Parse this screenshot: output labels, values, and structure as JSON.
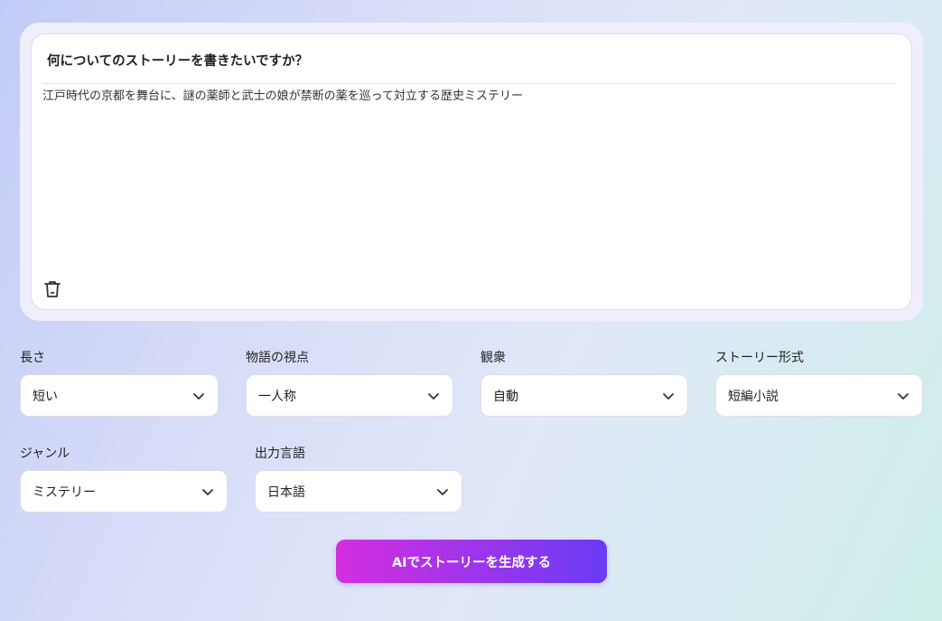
{
  "prompt": {
    "title": "何についてのストーリーを書きたいですか？",
    "value": "江戸時代の京都を舞台に、謎の薬師と武士の娘が禁断の薬を巡って対立する歴史ミステリー"
  },
  "fields": {
    "length": {
      "label": "長さ",
      "value": "短い"
    },
    "pov": {
      "label": "物語の視点",
      "value": "一人称"
    },
    "audience": {
      "label": "観衆",
      "value": "自動"
    },
    "format": {
      "label": "ストーリー形式",
      "value": "短編小説"
    },
    "genre": {
      "label": "ジャンル",
      "value": "ミステリー"
    },
    "language": {
      "label": "出力言語",
      "value": "日本語"
    }
  },
  "generate_button": {
    "label": "AIでストーリーを生成する"
  },
  "colors": {
    "button_start": "#d42ee0",
    "button_end": "#6a3bf5"
  }
}
